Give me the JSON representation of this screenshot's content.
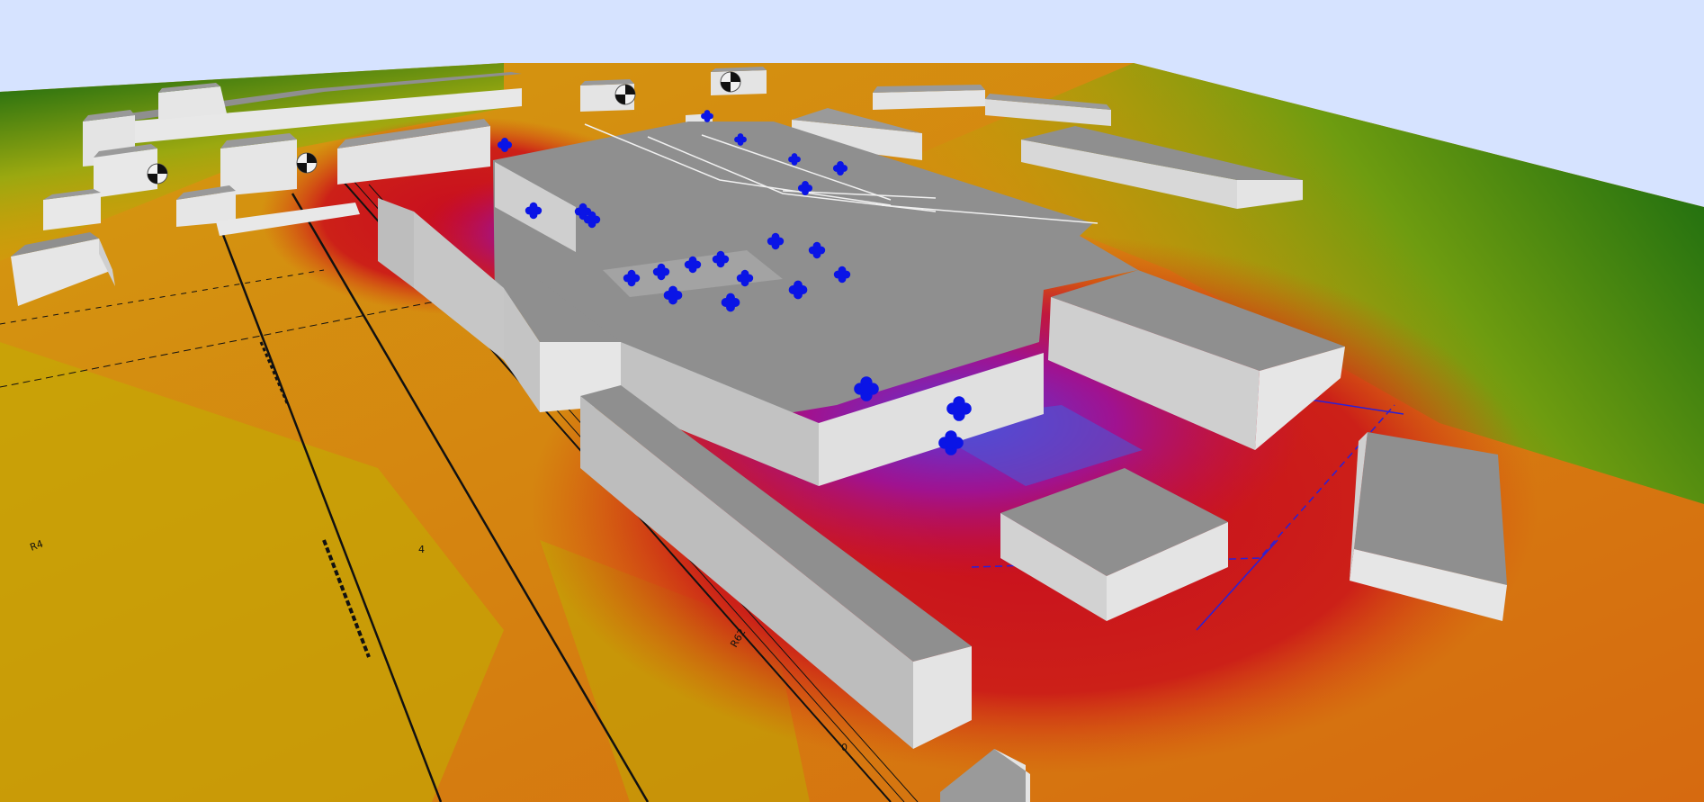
{
  "scene": {
    "sky_color": "#d6e3ff",
    "heatmap_colors": [
      "#0a6a10",
      "#7ca010",
      "#c8b400",
      "#e09000",
      "#d84a10",
      "#c81020",
      "#b00c70",
      "#7020c8",
      "#3050d8"
    ],
    "building_colors": {
      "roof": "#8f8f8f",
      "wall_light": "#e4e4e4",
      "wall_mid": "#c6c6c6",
      "wall_dark": "#a8a8a8"
    },
    "source_marker_color": "#0a14e6",
    "source_marker_icon": "noise-source-cross-icon",
    "receiver_marker_icon": "receiver-quadrant-icon",
    "track_annotations": [
      "R4",
      "R62",
      "4",
      "0"
    ]
  }
}
